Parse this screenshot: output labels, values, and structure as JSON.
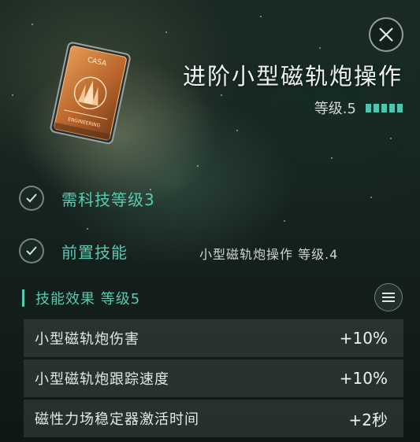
{
  "skill": {
    "title": "进阶小型磁轨炮操作",
    "level_label": "等级.5",
    "level_pips": 5
  },
  "card": {
    "logo_text": "CASA",
    "footer_text": "ENGINEERING"
  },
  "requirements": [
    {
      "label": "需科技等级3"
    },
    {
      "label": "前置技能",
      "value": "小型磁轨炮操作 等级.4"
    }
  ],
  "effects_section": {
    "title": "技能效果 等级5",
    "rows": [
      {
        "name": "小型磁轨炮伤害",
        "value": "+10%"
      },
      {
        "name": "小型磁轨炮跟踪速度",
        "value": "+10%"
      },
      {
        "name": "磁性力场稳定器激活时间",
        "value": "+2秒"
      }
    ]
  },
  "colors": {
    "accent": "#59c9b0",
    "pip": "#4fc3ab",
    "card_orange": "#c9783a"
  },
  "icons": {
    "close": "close-icon",
    "check": "check-icon",
    "menu": "menu-icon"
  }
}
